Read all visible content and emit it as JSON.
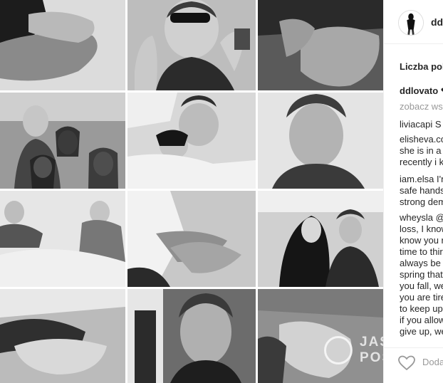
{
  "post": {
    "header_username": "ddl",
    "likes_text": "Liczba polu",
    "caption_user": "ddlovato",
    "caption_text": "❤",
    "see_all": "zobacz ws"
  },
  "comments": [
    {
      "user": "liviacapi",
      "lines": [
        "liviacapi S"
      ]
    },
    {
      "user": "elisheva.co",
      "lines": [
        "elisheva.co",
        "she is in a",
        "recently i k"
      ]
    },
    {
      "user": "iam.elsa",
      "lines": [
        "iam.elsa I'n",
        "safe hands",
        "strong dem"
      ]
    },
    {
      "user": "wheysla",
      "lines": [
        "wheysla @",
        "loss, I know",
        "know you r",
        "time to thir",
        "always be",
        "spring that",
        "you fall, we",
        "you are tire",
        "to keep up",
        "if you allow",
        "give up, we"
      ]
    }
  ],
  "footer": {
    "add_comment_placeholder": "Dodaj"
  },
  "watermark": {
    "line1": "JAS",
    "line2": "POS"
  },
  "colors": {
    "text": "#262626",
    "muted": "#999999",
    "border": "#efefef"
  },
  "icons": [
    "heart-icon",
    "avatar-icon"
  ]
}
